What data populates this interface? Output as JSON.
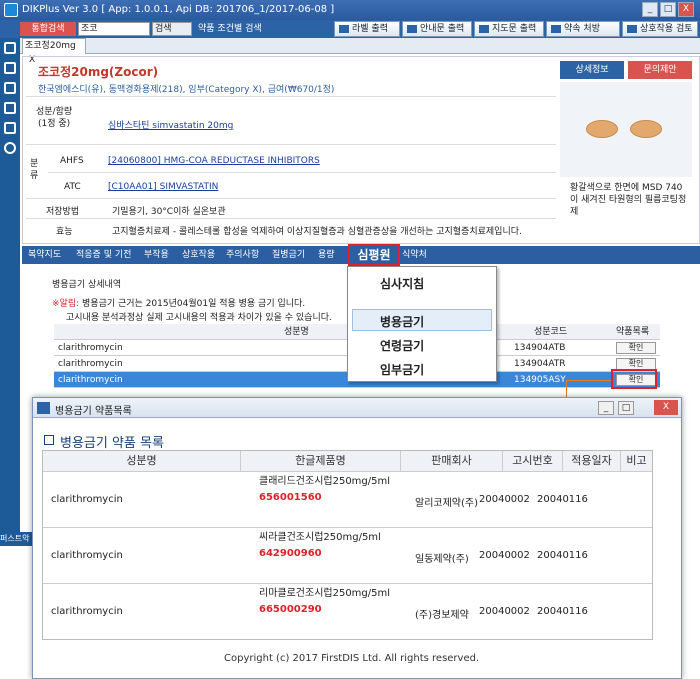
{
  "window": {
    "title": "DIKPlus Ver 3.0 [ App: 1.0.0.1, Api DB: 201706_1/2017-06-08 ]",
    "min": "_",
    "max": "□",
    "close": "X"
  },
  "toolbar": {
    "search_label": "통합검색",
    "search_value": "조코",
    "search_go": "검색",
    "condition_search": "약품 조건별 검색",
    "buttons": [
      "라벨 출력",
      "안내문 출력",
      "지도문 출력",
      "약속 처방",
      "상호작용 검토"
    ]
  },
  "tab": {
    "label": "조코정20mg",
    "close": "X"
  },
  "drug": {
    "name": "조코정20mg(Zocor)",
    "info": "한국엠에스디(유), 동맥경화용제(218), 임부(Category X), 급여(₩670/1정)",
    "ingredient_label": "성분/함량",
    "ingredient_sub": "(1정 중)",
    "ingredient_value": "심바스타틴 simvastatin 20mg",
    "class_label": "분류",
    "ahfs_label": "AHFS",
    "ahfs_value": "[24060800] HMG-COA REDUCTASE INHIBITORS",
    "atc_label": "ATC",
    "atc_value": "[C10AA01] SIMVASTATIN",
    "storage_label": "저장방법",
    "storage_value": "기밀용기, 30°C이하 실온보관",
    "effect_label": "효능",
    "effect_value": "고지혈증치료제 - 콜레스테롤 합성을 억제하여 이상지질혈증과 심혈관증상을 개선하는 고지혈증치료제입니다.",
    "detail_button": "상세정보",
    "inquiry_button": "문의제안",
    "pill_desc": "황갈색으로 한면에 MSD 740 이 새겨진 타원형의 필름코팅정제"
  },
  "nav": {
    "items": [
      "복약지도",
      "적응증 및 기전",
      "부작용",
      "상호작용",
      "주의사항",
      "질병금기",
      "용량",
      "심평원",
      "식약처"
    ],
    "active": "심평원"
  },
  "panel": {
    "title": "병용금기 상세내역",
    "alert_prefix": "※알림:",
    "alert": "병용금기 근거는 2015년04월01일 적용 병용 금기 입니다.",
    "alert2": "고시내용 분석과정상 실제 고시내용의 적용과 차이가 있을 수 있습니다.",
    "header": [
      "성분명",
      "성분코드",
      "약품목록"
    ],
    "rows": [
      {
        "name": "clarithromycin",
        "code": "134904ATB",
        "btn": "확인"
      },
      {
        "name": "clarithromycin",
        "code": "134904ATR",
        "btn": "확인"
      },
      {
        "name": "clarithromycin",
        "code": "134905ASY",
        "btn": "확인"
      }
    ]
  },
  "dropdown": {
    "items": [
      "심사지침",
      "병용금기",
      "연령금기",
      "임부금기"
    ],
    "selected": "병용금기"
  },
  "popup": {
    "title": "병용금기 약품목록",
    "heading": "병용금기 약품 목록",
    "columns": [
      "성분명",
      "한글제품명",
      "판매회사",
      "고시번호",
      "적용일자",
      "비고"
    ],
    "rows": [
      {
        "ingredient": "clarithromycin",
        "product": "클래리드건조시럽250mg/5ml",
        "code": "656001560",
        "company": "알리코제약(주)",
        "notice": "20040002",
        "date": "20040116",
        "note": ""
      },
      {
        "ingredient": "clarithromycin",
        "product": "씨라클건조시럽250mg/5ml",
        "code": "642900960",
        "company": "일동제약(주)",
        "notice": "20040002",
        "date": "20040116",
        "note": ""
      },
      {
        "ingredient": "clarithromycin",
        "product": "리마클로건조시럽250mg/5ml",
        "code": "665000290",
        "company": "(주)경보제약",
        "notice": "20040002",
        "date": "20040116",
        "note": ""
      }
    ],
    "copyright": "Copyright (c) 2017 FirstDIS Ltd. All rights reserved."
  },
  "bottom_label": "퍼스트악"
}
